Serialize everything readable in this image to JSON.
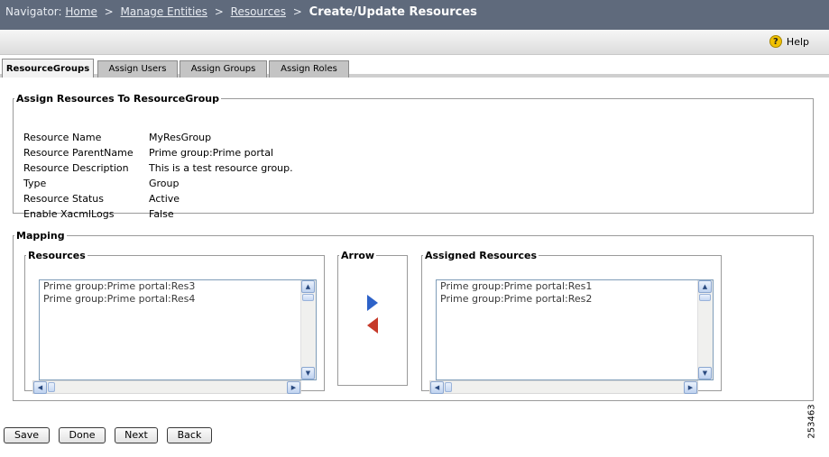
{
  "navigator": {
    "label": "Navigator:",
    "crumbs": [
      "Home",
      "Manage Entities",
      "Resources"
    ],
    "separator": ">",
    "current": "Create/Update Resources"
  },
  "help": {
    "label": "Help",
    "icon": "help-icon"
  },
  "tabs": [
    "ResourceGroups",
    "Assign Users",
    "Assign Groups",
    "Assign Roles"
  ],
  "active_tab": "ResourceGroups",
  "info": {
    "legend": "Assign Resources To ResourceGroup",
    "rows": [
      {
        "label": "Resource Name",
        "value": "MyResGroup"
      },
      {
        "label": "Resource ParentName",
        "value": "Prime group:Prime portal"
      },
      {
        "label": "Resource Description",
        "value": "This is a test resource group."
      },
      {
        "label": "Type",
        "value": "Group"
      },
      {
        "label": "Resource Status",
        "value": "Active"
      },
      {
        "label": "Enable XacmlLogs",
        "value": "False"
      }
    ]
  },
  "mapping": {
    "legend": "Mapping",
    "resources": {
      "legend": "Resources",
      "items": [
        "Prime group:Prime portal:Res3",
        "Prime group:Prime portal:Res4"
      ]
    },
    "arrow": {
      "legend": "Arrow"
    },
    "assigned": {
      "legend": "Assigned Resources",
      "items": [
        "Prime group:Prime portal:Res1",
        "Prime group:Prime portal:Res2"
      ]
    }
  },
  "buttons": {
    "save": "Save",
    "done": "Done",
    "next": "Next",
    "back": "Back"
  },
  "figure_id": "253463",
  "colors": {
    "nav_bg": "#5f6a7c",
    "arrow_assign": "#2d62c8",
    "arrow_remove": "#c63a2a"
  }
}
